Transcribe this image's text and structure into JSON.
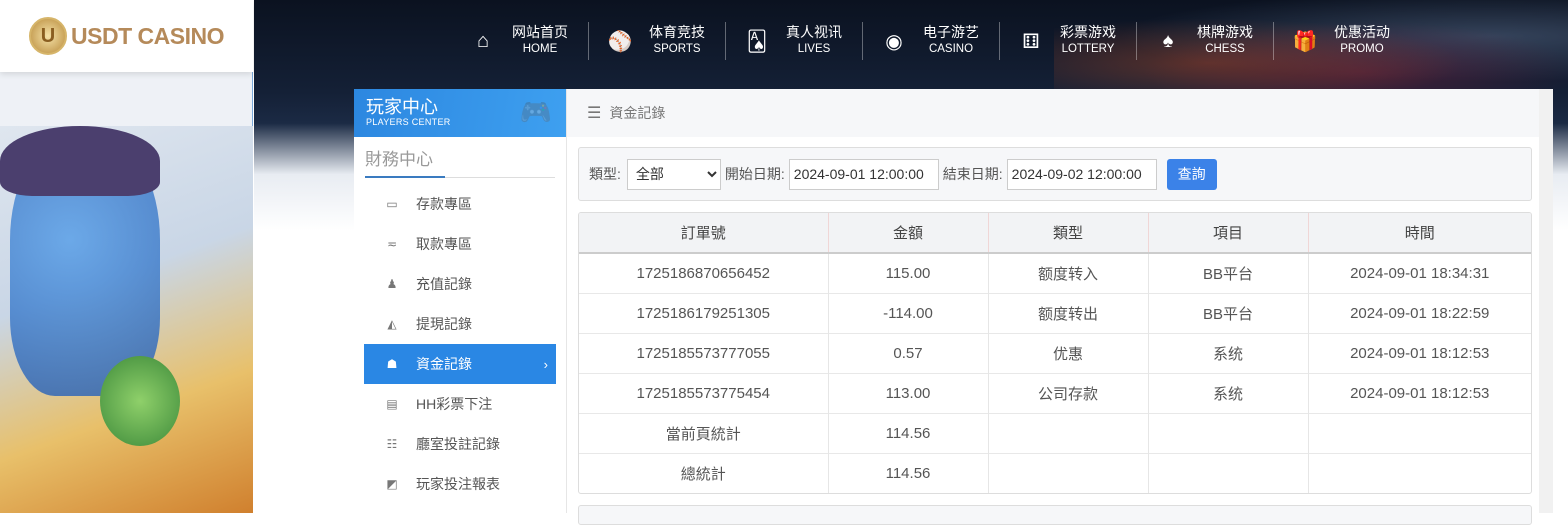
{
  "brand": {
    "logo_text": "USDT CASINO"
  },
  "nav": [
    {
      "cn": "网站首页",
      "en": "HOME",
      "icon": "home-icon",
      "glyph": "⌂"
    },
    {
      "cn": "体育竞技",
      "en": "SPORTS",
      "icon": "ball-icon",
      "glyph": "⚾"
    },
    {
      "cn": "真人视讯",
      "en": "LIVES",
      "icon": "cards-icon",
      "glyph": "🂡"
    },
    {
      "cn": "电子游艺",
      "en": "CASINO",
      "icon": "slot-icon",
      "glyph": "◉"
    },
    {
      "cn": "彩票游戏",
      "en": "LOTTERY",
      "icon": "dice-icon",
      "glyph": "⚅"
    },
    {
      "cn": "棋牌游戏",
      "en": "CHESS",
      "icon": "spade-icon",
      "glyph": "♠"
    },
    {
      "cn": "优惠活动",
      "en": "PROMO",
      "icon": "gift-icon",
      "glyph": "🎁"
    }
  ],
  "sidebar": {
    "title_cn": "玩家中心",
    "title_en": "PLAYERS CENTER",
    "section": "財務中心",
    "items": [
      {
        "label": "存款專區",
        "icon": "card-icon",
        "glyph": "▭"
      },
      {
        "label": "取款專區",
        "icon": "hand-cash-icon",
        "glyph": "≂"
      },
      {
        "label": "充值記錄",
        "icon": "money-bag-icon",
        "glyph": "♟"
      },
      {
        "label": "提現記錄",
        "icon": "wallet-icon",
        "glyph": "◭"
      },
      {
        "label": "資金記錄",
        "icon": "funds-icon",
        "glyph": "☗",
        "active": true
      },
      {
        "label": "HH彩票下注",
        "icon": "list-icon",
        "glyph": "▤"
      },
      {
        "label": "廳室投註記錄",
        "icon": "list-bullets-icon",
        "glyph": "☷"
      },
      {
        "label": "玩家投注報表",
        "icon": "chart-icon",
        "glyph": "◩"
      }
    ]
  },
  "breadcrumb": "資金記錄",
  "filter": {
    "type_label": "類型:",
    "type_value": "全部",
    "start_label": "開始日期:",
    "start_value": "2024-09-01 12:00:00",
    "end_label": "結束日期:",
    "end_value": "2024-09-02 12:00:00",
    "query_label": "查詢"
  },
  "table": {
    "headers": [
      "訂單號",
      "金額",
      "類型",
      "項目",
      "時間"
    ],
    "rows": [
      [
        "1725186870656452",
        "115.00",
        "额度转入",
        "BB平台",
        "2024-09-01 18:34:31"
      ],
      [
        "1725186179251305",
        "-114.00",
        "额度转出",
        "BB平台",
        "2024-09-01 18:22:59"
      ],
      [
        "1725185573777055",
        "0.57",
        "优惠",
        "系统",
        "2024-09-01 18:12:53"
      ],
      [
        "1725185573775454",
        "113.00",
        "公司存款",
        "系统",
        "2024-09-01 18:12:53"
      ],
      [
        "當前頁統計",
        "114.56",
        "",
        "",
        ""
      ],
      [
        "總統計",
        "114.56",
        "",
        "",
        ""
      ]
    ]
  }
}
